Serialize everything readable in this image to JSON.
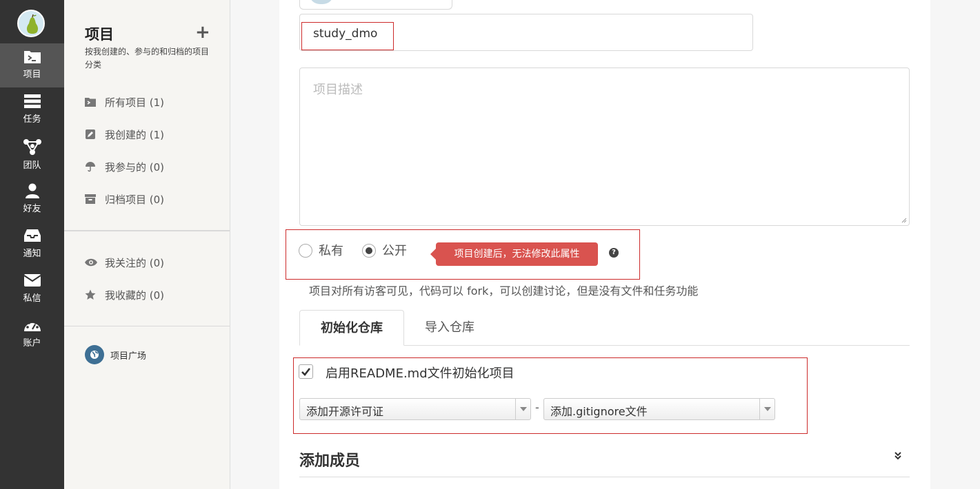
{
  "rail": {
    "items": [
      {
        "label": "项目",
        "icon": "project-icon"
      },
      {
        "label": "任务",
        "icon": "tasks-icon"
      },
      {
        "label": "团队",
        "icon": "team-icon"
      },
      {
        "label": "好友",
        "icon": "user-icon"
      },
      {
        "label": "通知",
        "icon": "inbox-icon"
      },
      {
        "label": "私信",
        "icon": "envelope-icon"
      },
      {
        "label": "账户",
        "icon": "dashboard-icon"
      }
    ],
    "active_color": "#555555",
    "bg_color": "#333333"
  },
  "sidebar": {
    "title": "项目",
    "add_label": "+",
    "subtitle": "按我创建的、参与的和归档的项目分类",
    "links": [
      {
        "label": "所有项目 (1)",
        "icon": "folder-terminal-icon"
      },
      {
        "label": "我创建的 (1)",
        "icon": "edit-icon"
      },
      {
        "label": "我参与的 (0)",
        "icon": "umbrella-icon"
      },
      {
        "label": "归档项目 (0)",
        "icon": "archive-icon"
      }
    ],
    "links2": [
      {
        "label": "我关注的 (0)",
        "icon": "eye-icon"
      },
      {
        "label": "我收藏的 (0)",
        "icon": "star-icon"
      }
    ],
    "square_label": "项目广场"
  },
  "form": {
    "name_value": "study_dmo",
    "desc_placeholder": "项目描述",
    "private_label": "私有",
    "public_label": "公开",
    "visibility": "public",
    "tooltip": "项目创建后，无法修改此属性",
    "help": "?",
    "visibility_desc": "项目对所有访客可见，代码可以 fork，可以创建讨论，但是没有文件和任务功能",
    "tabs": [
      "初始化仓库",
      "导入仓库"
    ],
    "readme_label": "启用README.md文件初始化项目",
    "readme_checked": true,
    "license_select": "添加开源许可证",
    "separator": "-",
    "gitignore_select": "添加.gitignore文件",
    "members_title": "添加成员"
  },
  "colors": {
    "highlight_box": "#cc2a2a",
    "tooltip_bg": "#d9534f"
  }
}
